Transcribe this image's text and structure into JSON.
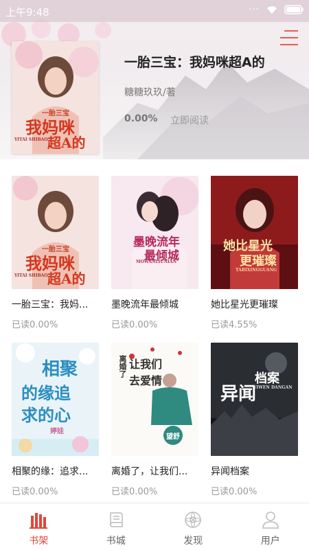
{
  "status": {
    "time": "上午9:48",
    "dots": "···"
  },
  "featured": {
    "title": "一胎三宝：我妈咪超A的",
    "author": "糖糖玖玖/著",
    "progress": "0.00%",
    "read_label": "立即阅读",
    "cover_text_small": "一胎三宝",
    "cover_text_big": "我妈咪",
    "cover_text_big2": "超A的",
    "cover_text_en": "YITAI SHIBAO"
  },
  "books": [
    {
      "title": "一胎三宝：我妈...",
      "progress": "已读0.00%",
      "cover_a": "一胎三宝",
      "cover_b": "我妈咪",
      "cover_c": "超A的",
      "cover_en": "YITAI SHIBAO"
    },
    {
      "title": "墨晚流年最倾城",
      "progress": "已读0.00%",
      "cover_a": "墨晚流年",
      "cover_b": "最倾城",
      "cover_en": "MOWANLIUNIAN"
    },
    {
      "title": "她比星光更璀璨",
      "progress": "已读4.55%",
      "cover_a": "她比星光",
      "cover_b": "更璀璨",
      "cover_en": "TABIXINGGUANG"
    },
    {
      "title": "相聚的缘：追求...",
      "progress": "已读0.00%",
      "cover_a": "相聚",
      "cover_b": "的缘追",
      "cover_c": "求的心",
      "cover_author": "婷娃"
    },
    {
      "title": "离婚了，让我们...",
      "progress": "已读0.00%",
      "cover_a": "离婚了",
      "cover_b": "让我们",
      "cover_c": "去爱情",
      "cover_author": "望舒"
    },
    {
      "title": "异闻档案",
      "progress": "已读0.00%",
      "cover_a": "档案",
      "cover_b": "异闻",
      "cover_en": "YIWEN DANGAN"
    }
  ],
  "nav": [
    {
      "label": "书架",
      "icon": "bookshelf-icon",
      "active": true
    },
    {
      "label": "书城",
      "icon": "book-city-icon",
      "active": false
    },
    {
      "label": "发现",
      "icon": "discover-icon",
      "active": false
    },
    {
      "label": "用户",
      "icon": "user-icon",
      "active": false
    }
  ],
  "colors": {
    "accent": "#e2463a",
    "menu": "#ea5b4f"
  }
}
